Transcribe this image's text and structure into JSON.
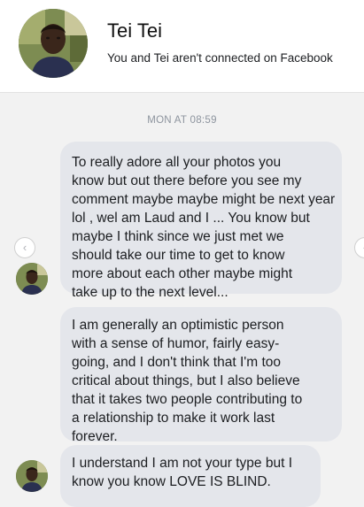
{
  "header": {
    "contact_name": "Tei Tei",
    "connection_status": "You and Tei aren't connected on Facebook"
  },
  "thread": {
    "timestamp": "MON AT 08:59",
    "messages": [
      {
        "lines": [
          "To really adore all your photos you",
          "know but out there before you see my",
          "comment maybe maybe might be next year",
          "lol , wel am Laud and I ... You know but",
          "maybe I think since we just met we",
          "should take our time to get to know",
          "more about each other maybe might",
          "take up to the next level..."
        ]
      },
      {
        "lines": [
          "I am generally an optimistic person",
          "with a sense of humor, fairly easy-",
          "going, and I don't think that I'm too",
          "critical about things, but I also believe",
          "that it takes two people contributing to",
          "a relationship to make it work last",
          "forever."
        ]
      },
      {
        "lines": [
          "I understand I am not your type but I",
          "know you know LOVE IS BLIND."
        ]
      }
    ]
  },
  "icons": {
    "prev": "chevron-left-icon",
    "next": "chevron-right-icon",
    "prev_glyph": "‹",
    "next_glyph": "‹"
  },
  "colors": {
    "bubble_background": "#e4e6eb",
    "thread_background": "#f2f2f2",
    "timestamp": "#8d949e"
  }
}
